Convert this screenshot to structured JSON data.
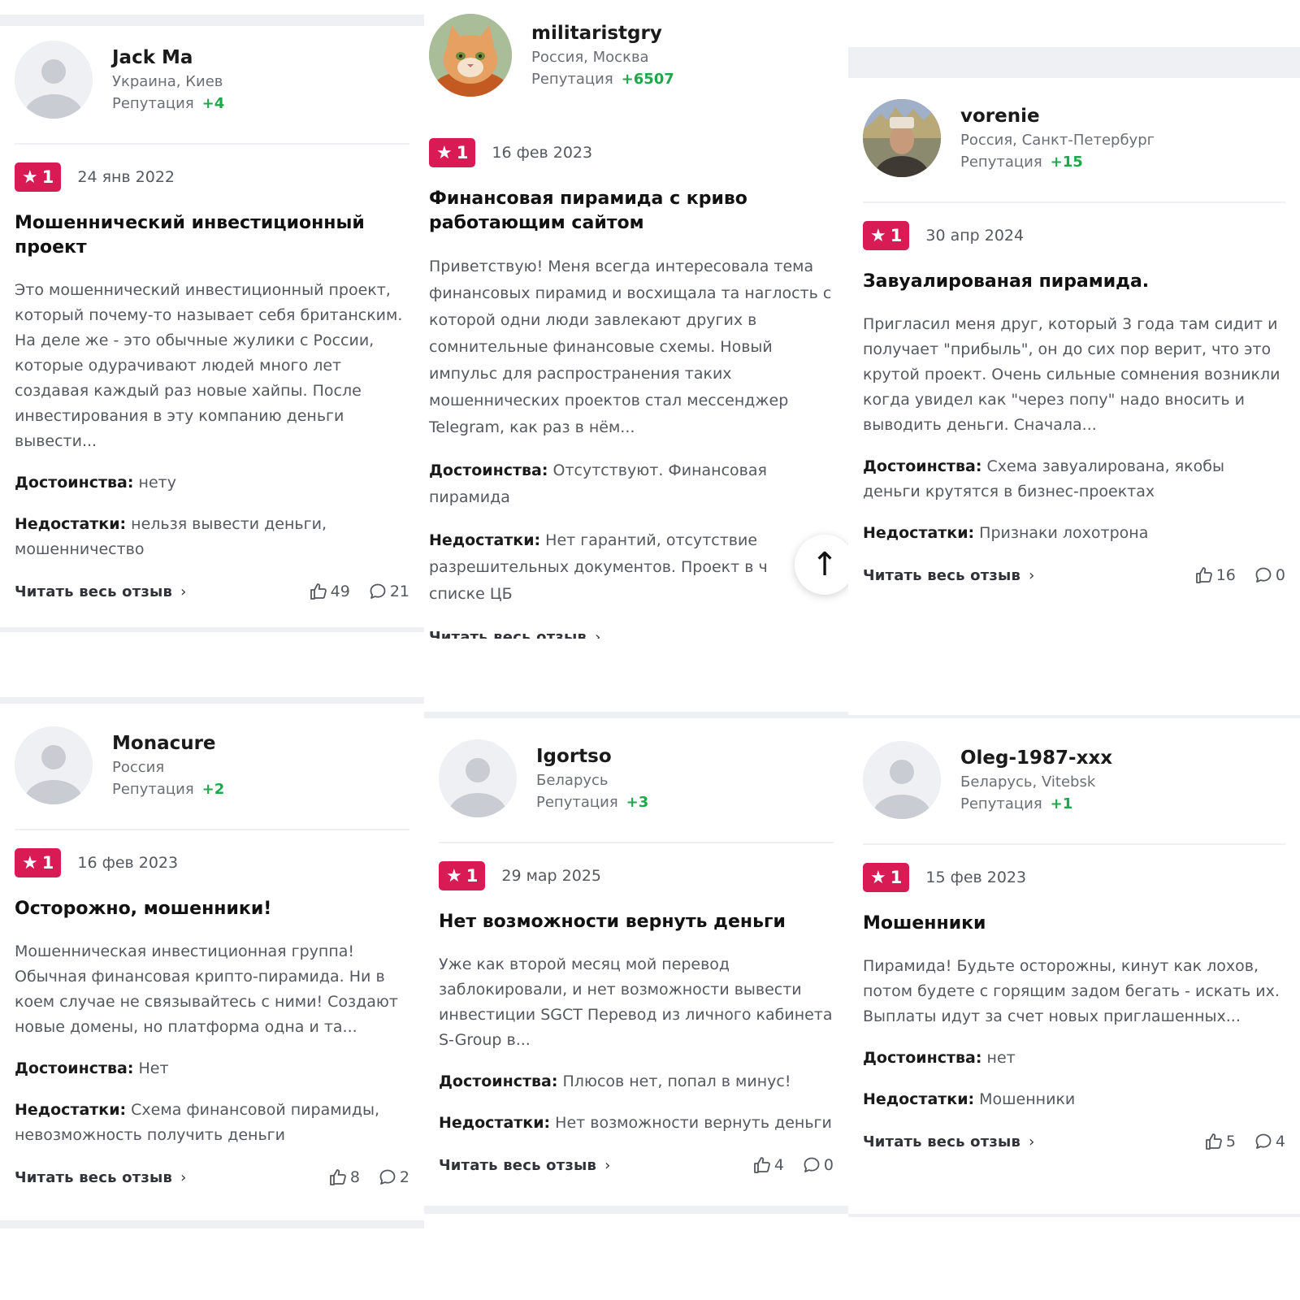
{
  "labels": {
    "reputation": "Репутация",
    "pros": "Достоинства:",
    "cons": "Недостатки:",
    "read_more": "Читать весь отзыв",
    "chevron": "›",
    "star": "★"
  },
  "reviews": [
    {
      "user": "Jack Ma",
      "location": "Украина, Киев",
      "reputation": "+4",
      "rating": "1",
      "date": "24 янв 2022",
      "title": "Мошеннический инвестиционный проект",
      "text": "Это мошеннический инвестиционный проект, который почему-то называет себя британским. На деле же - это обычные жулики с России, которые одурачивают людей много лет создавая каждый раз новые хайпы. После инвестирования в эту компанию деньги вывести...",
      "pros": "нету",
      "cons": "нельзя вывести деньги, мошенничество",
      "likes": "49",
      "comments": "21"
    },
    {
      "user": "militaristgry",
      "location": "Россия, Москва",
      "reputation": "+6507",
      "rating": "1",
      "date": "16 фев 2023",
      "title": "Финансовая пирамида с криво работающим сайтом",
      "text": "Приветствую! Меня всегда интересовала тема финансовых пирамид и восхищала та наглость с которой одни люди завлекают других в сомнительные финансовые схемы. Новый импульс для распространения таких мошеннических проектов стал мессенджер Telegram, как раз в нём...",
      "pros": "Отсутствуют. Финансовая пирамида",
      "cons": "Нет гарантий, отсутствие разрешительных документов. Проект в ч списке ЦБ",
      "likes": "",
      "comments": ""
    },
    {
      "user": "vorenie",
      "location": "Россия, Санкт-Петербург",
      "reputation": "+15",
      "rating": "1",
      "date": "30 апр 2024",
      "title": "Завуалированая пирамида.",
      "text": "Пригласил меня друг, который 3 года там сидит и получает \"прибыль\", он до сих пор верит, что это крутой проект. Очень сильные сомнения возникли когда увидел как \"через попу\" надо вносить и выводить деньги. Сначала...",
      "pros": "Схема завуалирована, якобы деньги крутятся в бизнес-проектах",
      "cons": "Признаки лохотрона",
      "likes": "16",
      "comments": "0"
    },
    {
      "user": "Monacure",
      "location": "Россия",
      "reputation": "+2",
      "rating": "1",
      "date": "16 фев 2023",
      "title": "Осторожно, мошенники!",
      "text": "Мошенническая инвестиционная группа! Обычная финансовая крипто-пирамида. Ни в коем случае не связывайтесь с ними! Создают новые домены, но платформа одна и та...",
      "pros": "Нет",
      "cons": "Схема финансовой пирамиды, невозможность получить деньги",
      "likes": "8",
      "comments": "2"
    },
    {
      "user": "Igortso",
      "location": "Беларусь",
      "reputation": "+3",
      "rating": "1",
      "date": "29 мар 2025",
      "title": "Нет возможности вернуть деньги",
      "text": "Уже как второй месяц мой перевод заблокировали, и нет возможности вывести инвестиции SGCT Перевод из личного кабинета S-Group в...",
      "pros": "Плюсов нет, попал в минус!",
      "cons": "Нет возможности вернуть деньги",
      "likes": "4",
      "comments": "0"
    },
    {
      "user": "Oleg-1987-xxx",
      "location": "Беларусь, Vitebsk",
      "reputation": "+1",
      "rating": "1",
      "date": "15 фев 2023",
      "title": "Мошенники",
      "text": "Пирамида! Будьте осторожны, кинут как лохов, потом будете с горящим задом бегать - искать их. Выплаты идут за счет новых приглашенных...",
      "pros": "нет",
      "cons": "Мошенники",
      "likes": "5",
      "comments": "4"
    }
  ],
  "scroll_top": {
    "glyph": "↑"
  },
  "colors": {
    "badge": "#d81b55",
    "reputation": "#1ea84a",
    "band": "#eef0f3"
  },
  "icons": [
    "avatar-placeholder-icon",
    "cat-avatar",
    "photo-avatar",
    "star-icon",
    "thumbs-up-icon",
    "comment-icon",
    "chevron-right-icon",
    "arrow-up-icon"
  ]
}
